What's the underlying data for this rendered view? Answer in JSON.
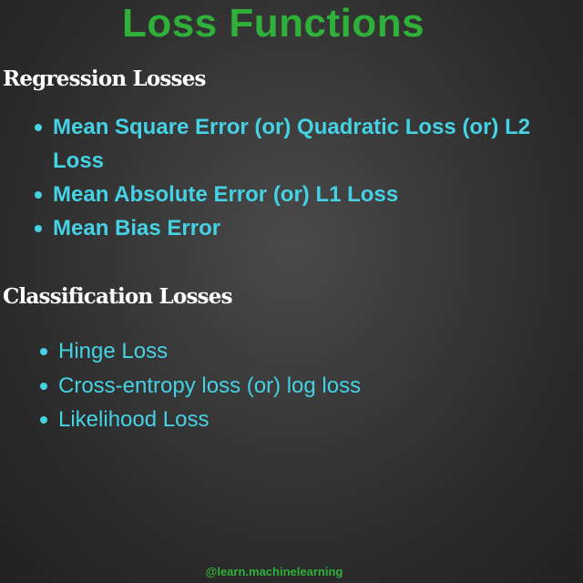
{
  "title": "Loss Functions",
  "sections": [
    {
      "heading": "Regression Losses",
      "items": [
        "Mean Square Error (or) Quadratic Loss (or) L2 Loss",
        "Mean Absolute Error (or) L1 Loss",
        "Mean Bias Error"
      ]
    },
    {
      "heading": "Classification Losses",
      "items": [
        "Hinge Loss",
        "Cross-entropy loss (or) log loss",
        "Likelihood Loss"
      ]
    }
  ],
  "footer": "@learn.machinelearning",
  "colors": {
    "title": "#2fb039",
    "heading": "#ffffff",
    "item": "#45d2e4",
    "background": "#333333"
  }
}
